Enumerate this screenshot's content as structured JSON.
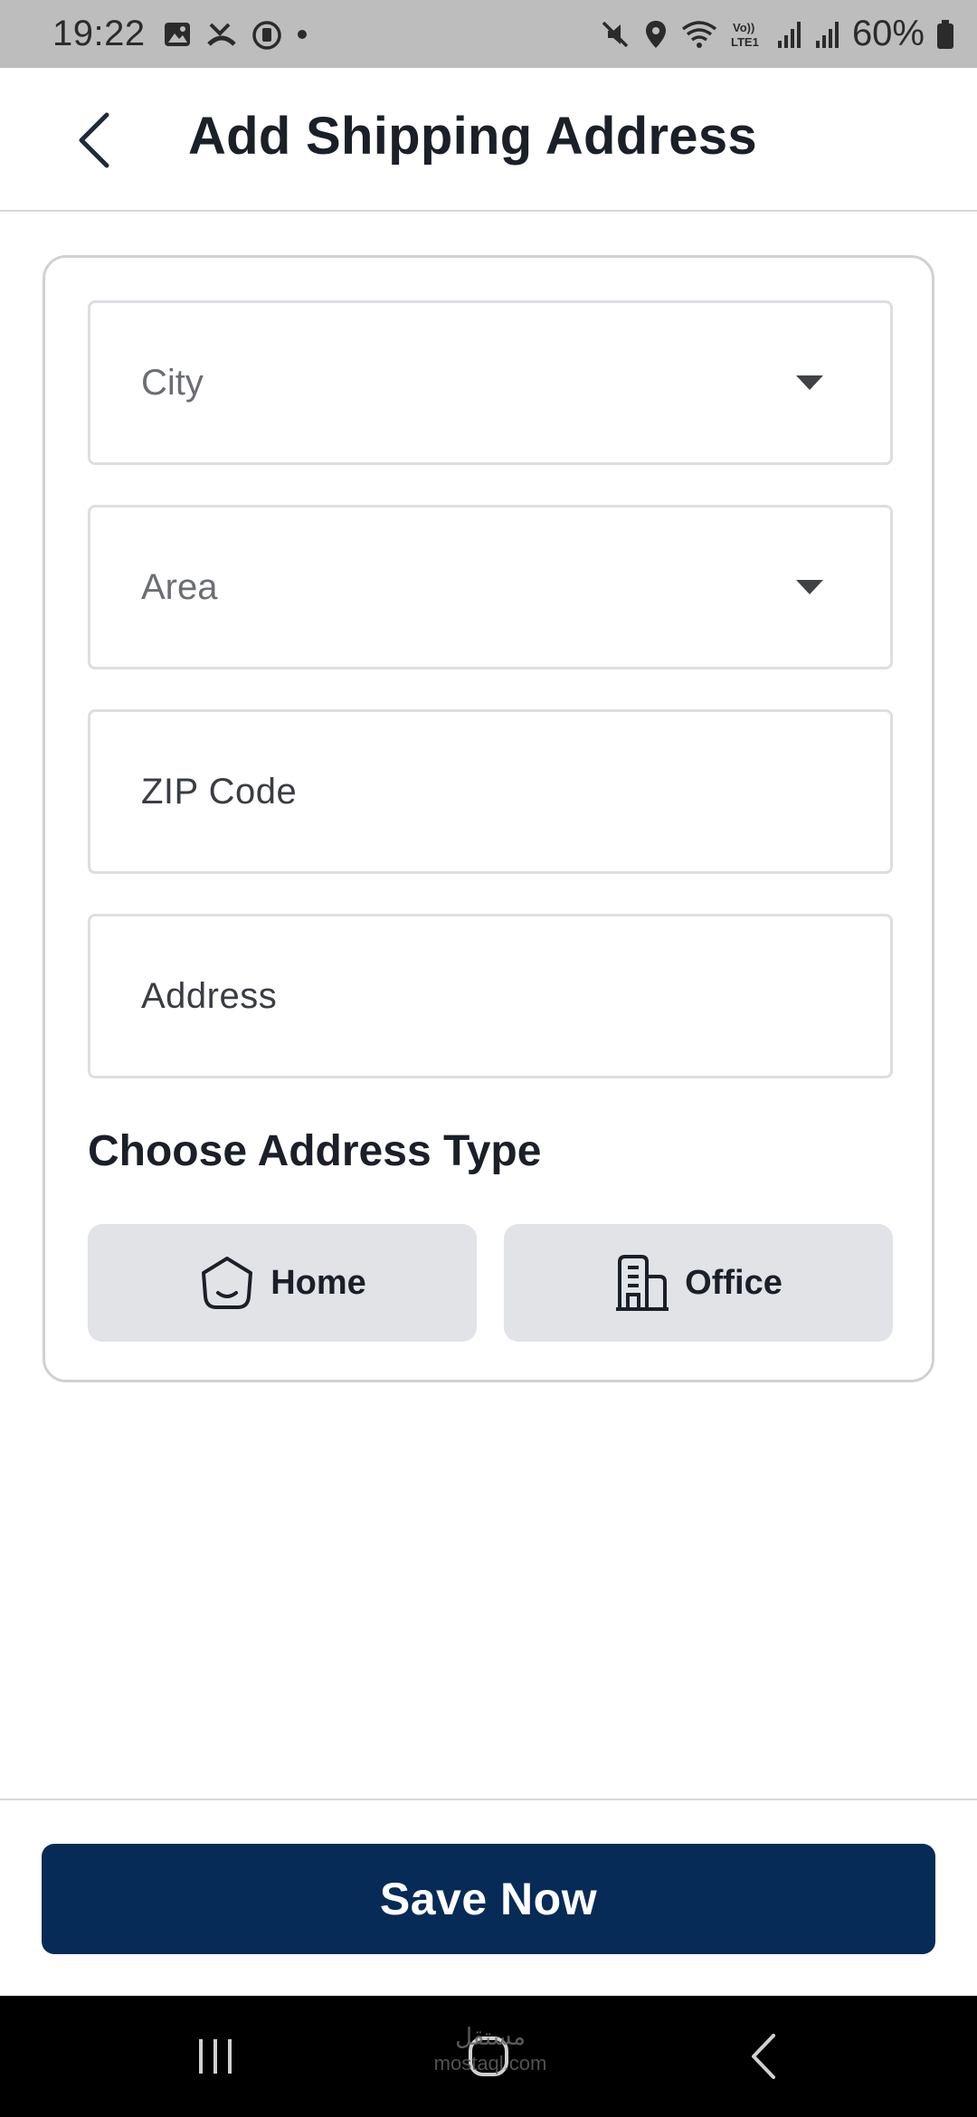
{
  "status_bar": {
    "time": "19:22",
    "battery": "60%",
    "icons_left": [
      "image-icon",
      "missed-call-icon",
      "stopwatch-icon",
      "dot-icon"
    ],
    "icons_right": [
      "mute-icon",
      "location-icon",
      "wifi-icon",
      "volte-icon",
      "signal-icon",
      "signal-icon",
      "battery-icon"
    ],
    "volte_label": "Vo)) LTE1"
  },
  "header": {
    "back_icon": "chevron-left-icon",
    "title": "Add Shipping Address"
  },
  "form": {
    "fields": [
      {
        "placeholder": "City",
        "type": "dropdown"
      },
      {
        "placeholder": "Area",
        "type": "dropdown"
      },
      {
        "placeholder": "ZIP Code",
        "type": "text"
      },
      {
        "placeholder": "Address",
        "type": "text"
      }
    ],
    "address_type_title": "Choose Address Type",
    "address_types": [
      {
        "label": "Home",
        "icon": "home-icon"
      },
      {
        "label": "Office",
        "icon": "office-building-icon"
      }
    ]
  },
  "footer": {
    "save_label": "Save Now"
  },
  "nav_bar": {
    "items": [
      "recent-apps-icon",
      "home-button-icon",
      "back-icon"
    ],
    "watermark": "مستقل",
    "watermark_sub": "mostaql.com"
  },
  "colors": {
    "primary": "#062b57",
    "type_button_bg": "#e1e3e7",
    "status_bar_bg": "#bdbdbd"
  }
}
